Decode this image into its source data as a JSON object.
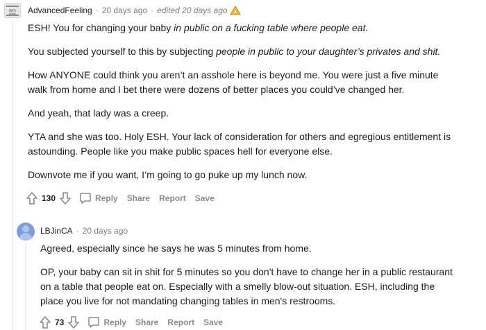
{
  "comment1": {
    "author": "AdvancedFeeling",
    "time": "20 days ago",
    "edited": "edited 20 days ago",
    "avatar_text": "DIRTY WAVE",
    "paragraphs": [
      {
        "pre": "ESH! You for changing your baby ",
        "em": "in public on a fucking table where people eat."
      },
      {
        "pre": "You subjected yourself to this by subjecting ",
        "em": "people in public to your daughter’s privates and shit."
      },
      {
        "pre": "How ANYONE could think you aren’t an asshole here is beyond me. You were just a five minute walk from home and I bet there were dozens of better places you could’ve changed her.",
        "em": ""
      },
      {
        "pre": "And yeah, that lady was a creep.",
        "em": ""
      },
      {
        "pre": "YTA and she was too. Holy ESH. Your lack of consideration for others and egregious entitlement is astounding. People like you make public spaces hell for everyone else.",
        "em": ""
      },
      {
        "pre": "Downvote me if you want, I’m going to go puke up my lunch now.",
        "em": ""
      }
    ],
    "score": "130",
    "actions": {
      "reply": "Reply",
      "share": "Share",
      "report": "Report",
      "save": "Save"
    }
  },
  "comment2": {
    "author": "LBJinCA",
    "time": "20 days ago",
    "paragraphs": [
      {
        "pre": "Agreed, especially since he says he was 5 minutes from home.",
        "em": ""
      },
      {
        "pre": "OP, your baby can sit in shit for 5 minutes so you don't have to change her in a public restaurant on a table that people eat on. Especially with a smelly blow-out situation. ESH, including the place you live for not mandating changing tables in men's restrooms.",
        "em": ""
      }
    ],
    "score": "73",
    "actions": {
      "reply": "Reply",
      "share": "Share",
      "report": "Report",
      "save": "Save"
    }
  },
  "colors": {
    "meta": "#7c7c7c",
    "action": "#878a8c",
    "text": "#1c1c1c",
    "thread": "#edeff1"
  }
}
